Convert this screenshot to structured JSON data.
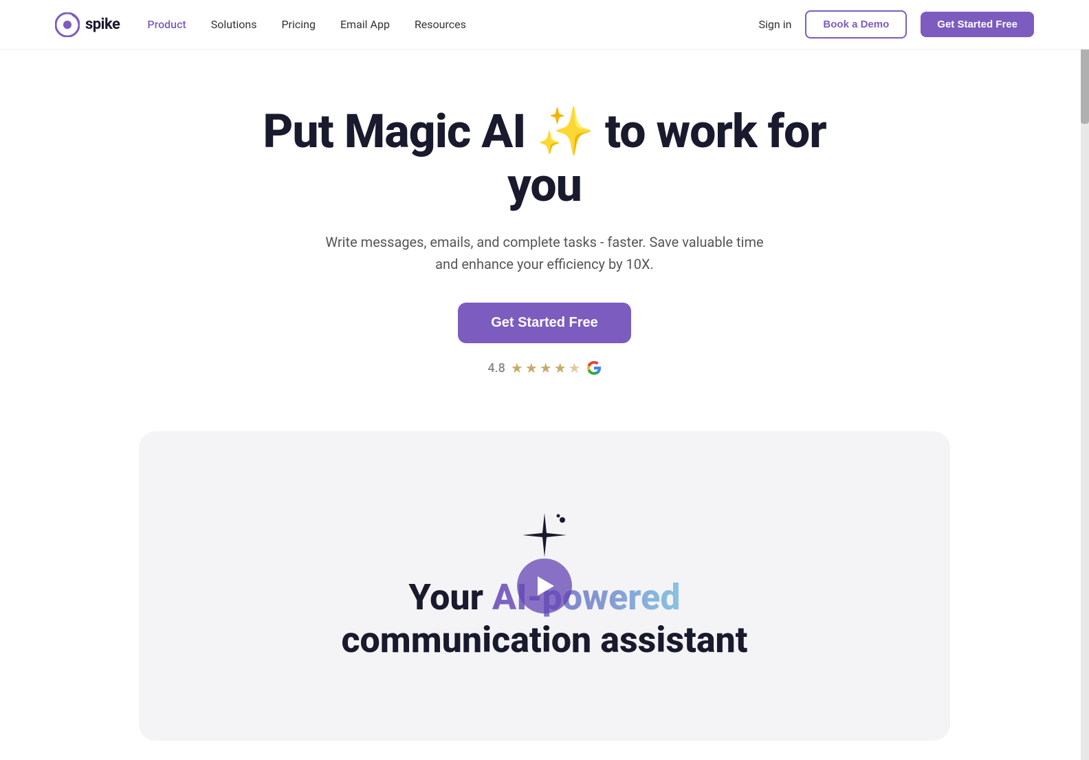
{
  "brand": {
    "name": "spike",
    "logo_alt": "Spike Logo"
  },
  "navbar": {
    "links": [
      {
        "label": "Product",
        "active": true
      },
      {
        "label": "Solutions",
        "active": false
      },
      {
        "label": "Pricing",
        "active": false
      },
      {
        "label": "Email App",
        "active": false
      },
      {
        "label": "Resources",
        "active": false
      }
    ],
    "sign_in_label": "Sign in",
    "book_demo_label": "Book a Demo",
    "get_started_label": "Get Started Free"
  },
  "hero": {
    "title_prefix": "Put Magic AI",
    "sparkle_emoji": "✨",
    "title_suffix": "to work for you",
    "subtitle": "Write messages, emails, and complete tasks - faster. Save valuable time and enhance your efficiency by 10X.",
    "cta_label": "Get Started Free",
    "rating_value": "4.8",
    "stars": [
      1,
      1,
      1,
      1,
      0.5
    ],
    "google_label": "G"
  },
  "demo_card": {
    "sparkle_char": "✦",
    "sparkle_dots": [
      "·",
      "·"
    ],
    "title_prefix": "Your ",
    "title_gradient": "AI-powered",
    "title_suffix": "communication assistant",
    "play_label": "Play Video"
  },
  "colors": {
    "purple": "#7c5cbf",
    "gradient_start": "#7c5cbf",
    "gradient_end": "#89c4e1",
    "star_color": "#c8a96a",
    "text_dark": "#1a1a2e",
    "text_muted": "#555555"
  }
}
